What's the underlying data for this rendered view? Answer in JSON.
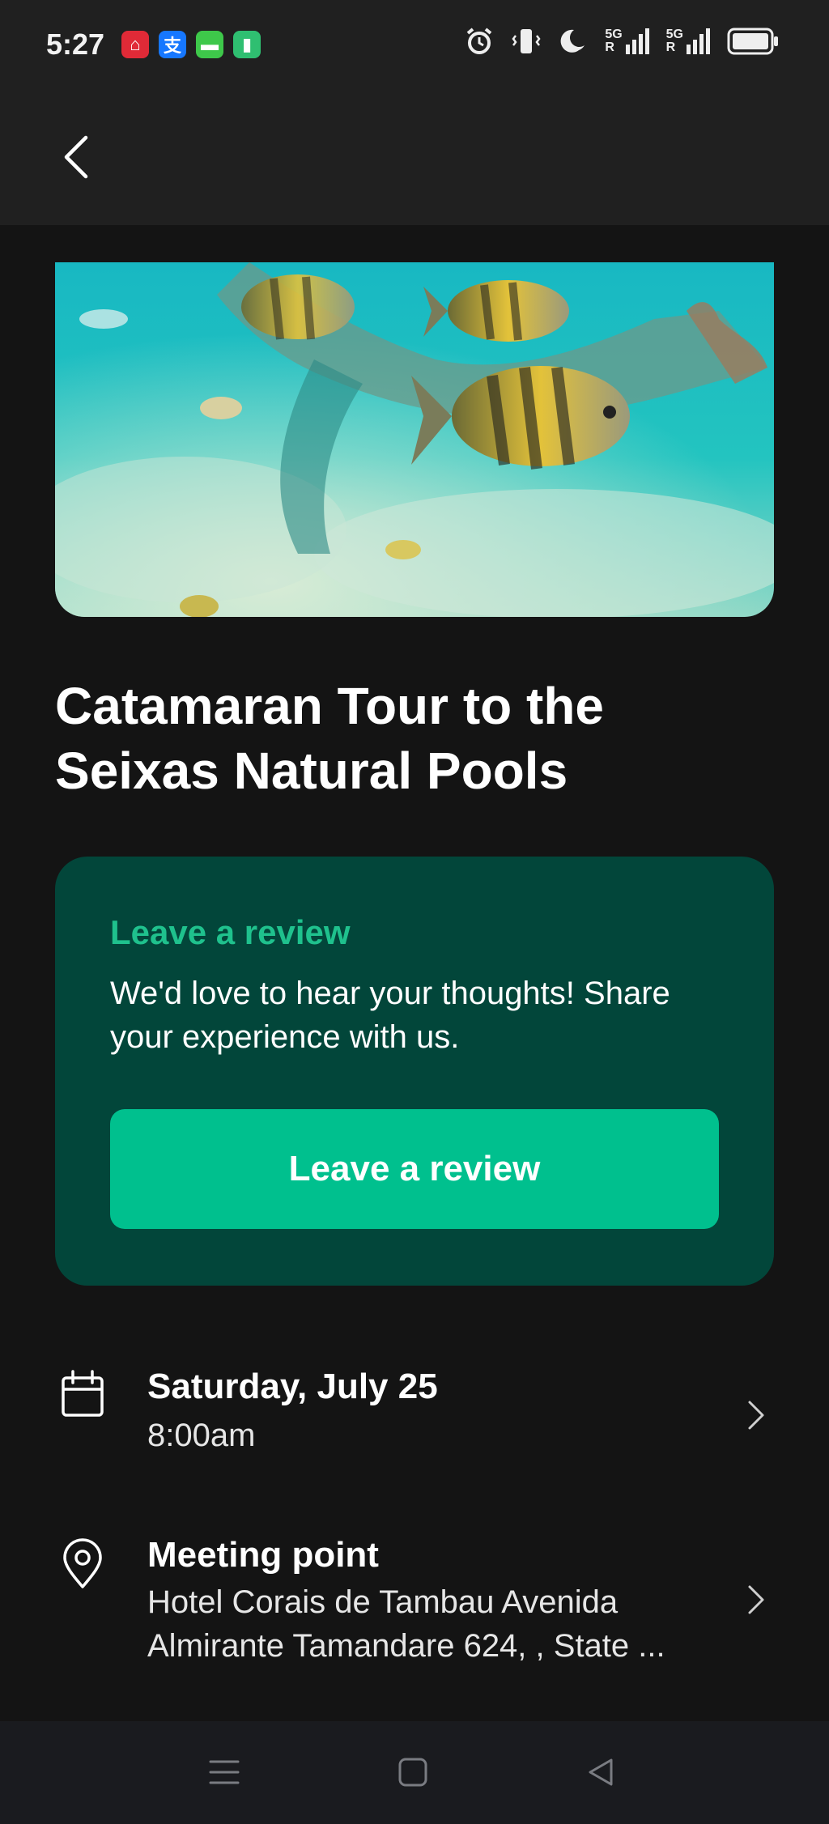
{
  "status_bar": {
    "time": "5:27",
    "notification_icons": [
      {
        "name": "app-red-icon",
        "color": "#e02a37",
        "glyph": "⌂"
      },
      {
        "name": "alipay-icon",
        "color": "#1677ff",
        "glyph": "支"
      },
      {
        "name": "messages-icon",
        "color": "#3ec84a",
        "glyph": "▬"
      },
      {
        "name": "battery-saver-icon",
        "color": "#2fbf71",
        "glyph": "▮"
      }
    ],
    "signal_1_label": "5G",
    "signal_2_label": "5G",
    "signal_roaming": "R"
  },
  "header": {
    "back_icon": "back-chevron-icon"
  },
  "tour": {
    "title": "Catamaran Tour to the Seixas Natural Pools"
  },
  "review_card": {
    "heading": "Leave a review",
    "text": "We'd love to hear your thoughts! Share your experience with us.",
    "button_label": "Leave a review",
    "colors": {
      "card": "#02463a",
      "accent": "#1fc18d",
      "button": "#00c08e"
    }
  },
  "date_row": {
    "icon": "calendar-icon",
    "title": "Saturday, July 25",
    "subtitle": "8:00am"
  },
  "meeting_row": {
    "icon": "location-pin-icon",
    "title": "Meeting point",
    "subtitle": "Hotel Corais de Tambau Avenida Almirante Tamandare 624, , State ..."
  },
  "nav_bar": {
    "items": [
      "menu-icon",
      "home-square-icon",
      "back-triangle-icon"
    ]
  }
}
